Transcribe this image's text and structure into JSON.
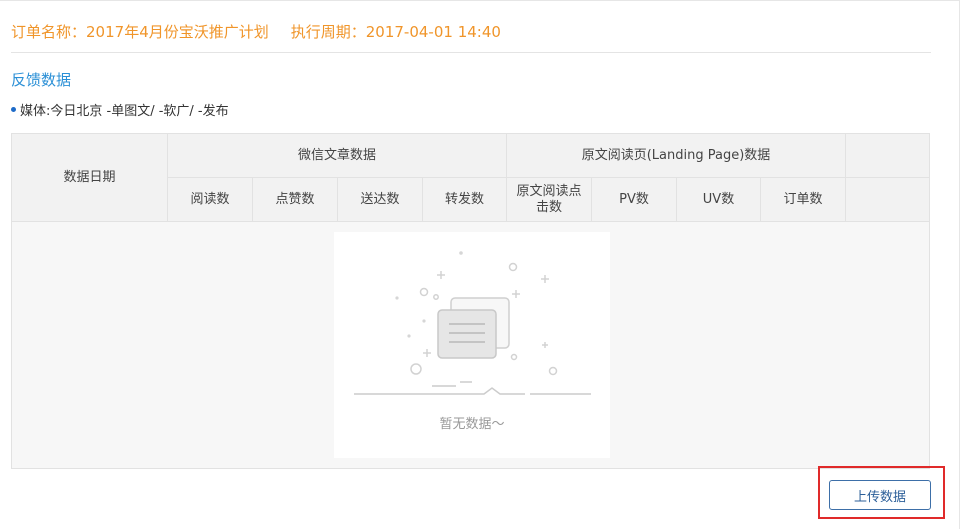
{
  "order": {
    "name_label": "订单名称：",
    "name_value": "2017年4月份宝沃推广计划",
    "period_label": "执行周期：",
    "period_value": "2017-04-01 14:40"
  },
  "feedback": {
    "title": "反馈数据",
    "media_line": "媒体:今日北京 -单图文/ -软广/ -发布"
  },
  "table": {
    "date_header": "数据日期",
    "wechat_group": "微信文章数据",
    "landing_group": "原文阅读页(Landing Page)数据",
    "wechat_columns": [
      "阅读数",
      "点赞数",
      "送达数",
      "转发数"
    ],
    "landing_first_line1": "原文阅读点",
    "landing_first_line2": "击数",
    "landing_columns": [
      "PV数",
      "UV数",
      "订单数"
    ]
  },
  "empty_state": {
    "text": "暂无数据～",
    "icon": "empty-documents-illustration"
  },
  "actions": {
    "upload_label": "上传数据"
  },
  "colors": {
    "header_orange": "#f0952a",
    "link_blue": "#2a8fd6",
    "highlight_red": "#e02a2a",
    "button_blue": "#2c5f99"
  }
}
